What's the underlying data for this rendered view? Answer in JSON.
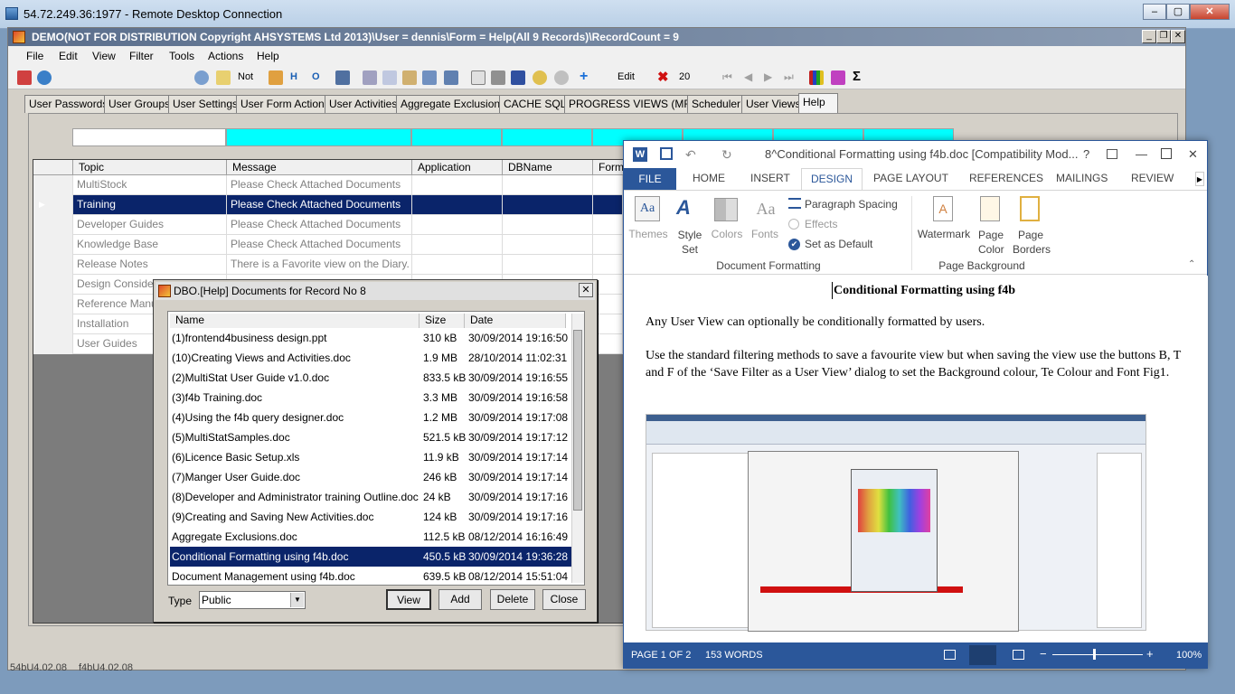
{
  "rdp": {
    "title": "54.72.249.36:1977 - Remote Desktop Connection"
  },
  "app": {
    "title": "DEMO(NOT FOR DISTRIBUTION Copyright AHSYSTEMS Ltd 2013)\\User = dennis\\Form = Help(All 9 Records)\\RecordCount = 9",
    "menu": [
      "File",
      "Edit",
      "View",
      "Filter",
      "Tools",
      "Actions",
      "Help"
    ],
    "toolbar": {
      "not_label": "Not",
      "h_label": "H",
      "o_label": "O",
      "edit_label": "Edit",
      "count": "20",
      "sigma": "Σ"
    },
    "tabs": [
      "User Passwords",
      "User Groups",
      "User Settings",
      "User Form Actions",
      "User Activities",
      "Aggregate Exclusions",
      "CACHE SQL",
      "PROGRESS VIEWS (MF)",
      "Scheduler",
      "User Views",
      "Help"
    ],
    "active_tab": "Help",
    "grid": {
      "headers": [
        "Topic",
        "Message",
        "Application",
        "DBName",
        "FormN"
      ],
      "rows": [
        {
          "topic": "MultiStock",
          "message": "Please Check Attached Documents"
        },
        {
          "topic": "Training",
          "message": "Please Check Attached Documents"
        },
        {
          "topic": "Developer Guides",
          "message": "Please Check Attached Documents"
        },
        {
          "topic": "Knowledge Base",
          "message": "Please Check Attached Documents"
        },
        {
          "topic": "Release Notes",
          "message": "There is a Favorite view on the Diary. H..."
        },
        {
          "topic": "Design Considerat",
          "message": ""
        },
        {
          "topic": "Reference Manua",
          "message": ""
        },
        {
          "topic": "Installation",
          "message": ""
        },
        {
          "topic": "User Guides",
          "message": ""
        }
      ],
      "selected_index": 1
    },
    "footer": {
      "left": "54bU4.02.08",
      "right": "f4bU4.02.08"
    }
  },
  "dialog": {
    "title": "DBO.[Help] Documents for Record No 8",
    "headers": [
      "Name",
      "Size",
      "Date"
    ],
    "files": [
      {
        "name": "(1)frontend4business design.ppt",
        "size": "310 kB",
        "date": "30/09/2014 19:16:50"
      },
      {
        "name": "(10)Creating Views and Activities.doc",
        "size": "1.9 MB",
        "date": "28/10/2014 11:02:31"
      },
      {
        "name": "(2)MultiStat User Guide v1.0.doc",
        "size": "833.5 kB",
        "date": "30/09/2014 19:16:55"
      },
      {
        "name": "(3)f4b Training.doc",
        "size": "3.3 MB",
        "date": "30/09/2014 19:16:58"
      },
      {
        "name": "(4)Using the f4b query designer.doc",
        "size": "1.2 MB",
        "date": "30/09/2014 19:17:08"
      },
      {
        "name": "(5)MultiStatSamples.doc",
        "size": "521.5 kB",
        "date": "30/09/2014 19:17:12"
      },
      {
        "name": "(6)Licence Basic Setup.xls",
        "size": "11.9 kB",
        "date": "30/09/2014 19:17:14"
      },
      {
        "name": "(7)Manger User Guide.doc",
        "size": "246 kB",
        "date": "30/09/2014 19:17:14"
      },
      {
        "name": "(8)Developer and Administrator training Outline.doc",
        "size": "24 kB",
        "date": "30/09/2014 19:17:16"
      },
      {
        "name": "(9)Creating and Saving New Activities.doc",
        "size": "124 kB",
        "date": "30/09/2014 19:17:16"
      },
      {
        "name": "Aggregate Exclusions.doc",
        "size": "112.5 kB",
        "date": "08/12/2014 16:16:49"
      },
      {
        "name": "Conditional Formatting using f4b.doc",
        "size": "450.5 kB",
        "date": "30/09/2014 19:36:28"
      },
      {
        "name": "Document Management using f4b.doc",
        "size": "639.5 kB",
        "date": "08/12/2014 15:51:04"
      }
    ],
    "selected_index": 11,
    "type_label": "Type",
    "type_value": "Public",
    "buttons": {
      "view": "View",
      "add": "Add",
      "delete": "Delete",
      "close": "Close"
    }
  },
  "word": {
    "title": "8^Conditional Formatting using f4b.doc [Compatibility Mod...",
    "help": "?",
    "tabs": [
      "FILE",
      "HOME",
      "INSERT",
      "DESIGN",
      "PAGE LAYOUT",
      "REFERENCES",
      "MAILINGS",
      "REVIEW"
    ],
    "active_tab": "DESIGN",
    "ribbon": {
      "themes": "Themes",
      "style_set": "Style Set",
      "colors": "Colors",
      "fonts": "Fonts",
      "paragraph_spacing": "Paragraph Spacing",
      "effects": "Effects",
      "set_default": "Set as Default",
      "group1": "Document Formatting",
      "watermark": "Watermark",
      "page_color": "Page Color",
      "page_borders": "Page Borders",
      "group2": "Page Background"
    },
    "doc": {
      "heading": "Conditional Formatting using f4b",
      "p1": "Any User View can optionally be conditionally formatted by users.",
      "p2": "Use the standard filtering methods to save a favourite view but when saving the view use the buttons B, T and F of the ‘Save Filter as a User View’ dialog to set the Background colour, Te Colour and Font Fig1."
    },
    "status": {
      "page": "PAGE 1 OF 2",
      "words": "153 WORDS",
      "zoom": "100%"
    }
  },
  "colors": {
    "accent_word": "#2b579a",
    "selection": "#0a246a",
    "cyan": "#00ffff"
  }
}
